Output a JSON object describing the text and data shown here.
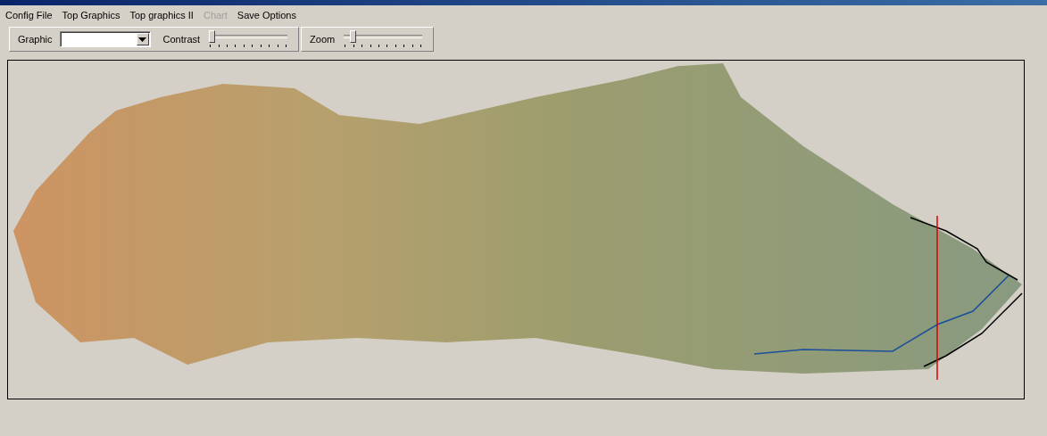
{
  "menu": [
    {
      "label": "Config File",
      "disabled": false
    },
    {
      "label": "Top Graphics",
      "disabled": false
    },
    {
      "label": "Top graphics II",
      "disabled": false
    },
    {
      "label": "Chart",
      "disabled": true
    },
    {
      "label": "Save Options",
      "disabled": false
    }
  ],
  "toolbar": {
    "graphic_label": "Graphic",
    "contrast_label": "Contrast",
    "contrast": {
      "level": 0.02
    },
    "zoom_label": "Zoom",
    "zoom": {
      "level": 0.1
    }
  }
}
